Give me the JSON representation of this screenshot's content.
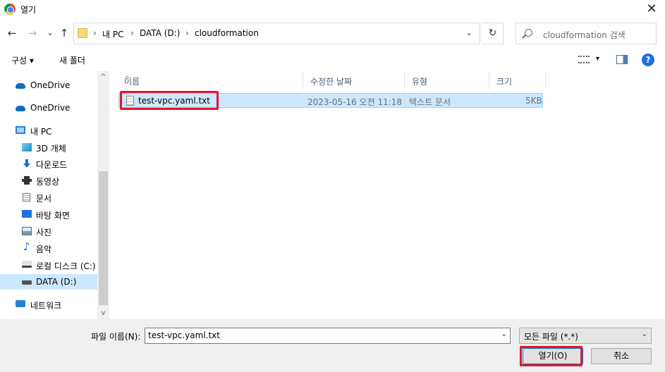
{
  "window": {
    "title": "열기",
    "close_glyph": "✕"
  },
  "nav": {
    "back": "←",
    "forward": "→",
    "recent": "⌄",
    "up": "↑",
    "breadcrumb": [
      "내 PC",
      "DATA (D:)",
      "cloudformation"
    ],
    "separator": "›",
    "dropdown": "⌄",
    "refresh": "↻",
    "search_placeholder": "cloudformation 검색"
  },
  "commands": {
    "organize": "구성 ▾",
    "new_folder": "새 폴더",
    "help": "?"
  },
  "sidebar": {
    "items": [
      {
        "label": "OneDrive"
      },
      {
        "label": "OneDrive"
      },
      {
        "label": "내 PC"
      },
      {
        "label": "3D 개체"
      },
      {
        "label": "다운로드"
      },
      {
        "label": "동영상"
      },
      {
        "label": "문서"
      },
      {
        "label": "바탕 화면"
      },
      {
        "label": "사진"
      },
      {
        "label": "음악"
      },
      {
        "label": "로컬 디스크 (C:)"
      },
      {
        "label": "DATA (D:)",
        "selected": true
      },
      {
        "label": "네트워크"
      }
    ],
    "scroll_up": "^",
    "scroll_down": "v"
  },
  "columns": {
    "name": "이름",
    "modified": "수정한 날짜",
    "type": "유형",
    "size": "크기",
    "sort_glyph": "^"
  },
  "files": [
    {
      "name": "test-vpc.yaml.txt",
      "modified": "2023-05-16 오전 11:18",
      "type": "텍스트 문서",
      "size": "5KB"
    }
  ],
  "footer": {
    "filename_label": "파일 이름(N):",
    "filename_value": "test-vpc.yaml.txt",
    "filetype_value": "모든 파일 (*.*)",
    "open_label": "열기(O)",
    "cancel_label": "취소"
  },
  "colors": {
    "selection": "#cce8ff",
    "highlight": "#e2182c",
    "accent": "#0078d7"
  }
}
